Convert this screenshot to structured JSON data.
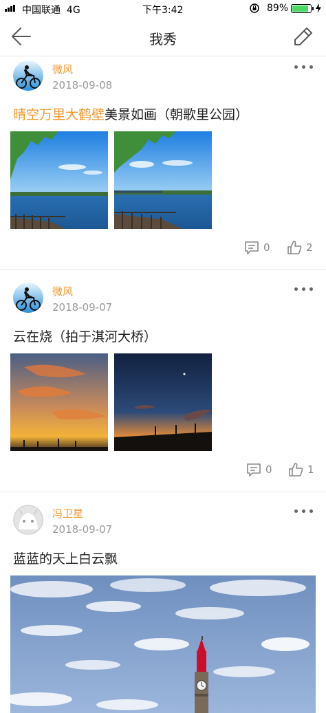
{
  "status_bar": {
    "carrier": "中国联通",
    "network": "4G",
    "time": "下午3:42",
    "battery": "89%",
    "battery_level": 0.89
  },
  "nav": {
    "title": "我秀",
    "back_icon": "back-arrow-icon",
    "edit_icon": "pencil-edit-icon"
  },
  "colors": {
    "accent": "#f4962c",
    "date": "#9a9a9a",
    "battery": "#4cd964"
  },
  "posts": [
    {
      "user": "微风",
      "date": "2018-09-08",
      "text_highlight": "晴空万里大鹤壁",
      "text_rest": "美景如画（朝歌里公园）",
      "comments": "0",
      "likes": "2"
    },
    {
      "user": "微风",
      "date": "2018-09-07",
      "text_highlight": "",
      "text_rest": "云在烧（拍于淇河大桥）",
      "comments": "0",
      "likes": "1"
    },
    {
      "user": "冯卫星",
      "date": "2018-09-07",
      "text_highlight": "",
      "text_rest": "蓝蓝的天上白云飘"
    }
  ]
}
